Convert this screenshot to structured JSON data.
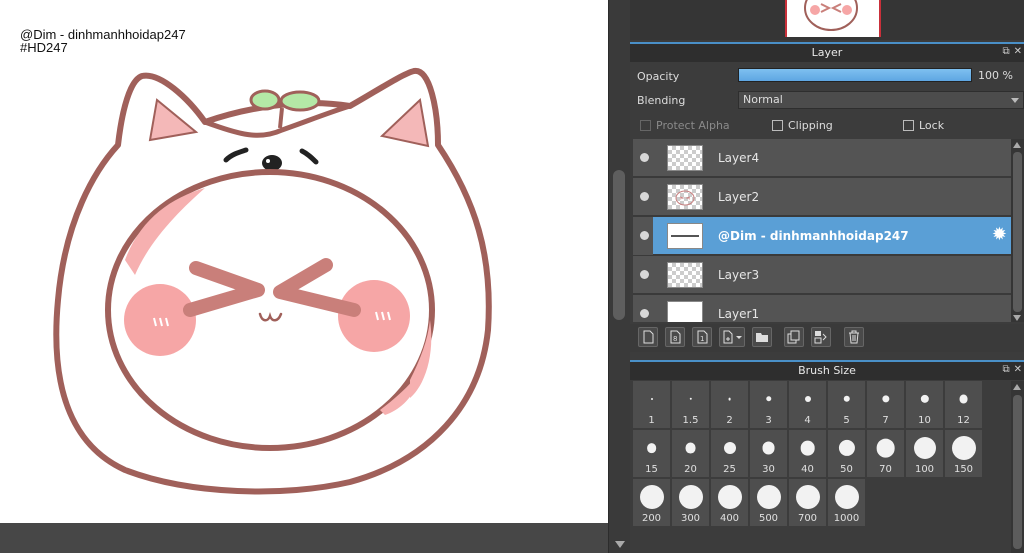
{
  "canvas": {
    "watermark_line1": "@Dim - dinhmanhhoidap247",
    "watermark_line2": "#HD247"
  },
  "layer_panel": {
    "title": "Layer",
    "opacity_label": "Opacity",
    "opacity_percent": 100,
    "opacity_text": "100 %",
    "blending_label": "Blending",
    "blending_value": "Normal",
    "protect_alpha_label": "Protect Alpha",
    "clipping_label": "Clipping",
    "lock_label": "Lock",
    "layers": [
      {
        "name": "Layer4",
        "thumb": "transparent",
        "visible": true,
        "selected": false
      },
      {
        "name": "Layer2",
        "thumb": "sketch",
        "visible": true,
        "selected": false
      },
      {
        "name": "@Dim - dinhmanhhoidap247",
        "thumb": "text",
        "visible": true,
        "selected": true
      },
      {
        "name": "Layer3",
        "thumb": "transparent",
        "visible": true,
        "selected": false
      },
      {
        "name": "Layer1",
        "thumb": "white",
        "visible": true,
        "selected": false
      }
    ],
    "toolbar_icons": [
      "new-layer-icon",
      "new-8bit-layer-icon",
      "new-1bit-layer-icon",
      "add-layer-menu-icon",
      "folder-icon",
      "duplicate-layer-icon",
      "merge-down-icon",
      "delete-layer-icon"
    ]
  },
  "brush_panel": {
    "title": "Brush Size",
    "sizes": [
      "1",
      "1.5",
      "2",
      "3",
      "4",
      "5",
      "7",
      "10",
      "12",
      "15",
      "20",
      "25",
      "30",
      "40",
      "50",
      "70",
      "100",
      "150",
      "200",
      "300",
      "400",
      "500",
      "700",
      "1000"
    ]
  },
  "colors": {
    "accent_blue": "#5a9fd6",
    "panel_bg": "#3c3c3c",
    "outline_brown": "#a0605a",
    "blush_pink": "#f6a6a6",
    "sprout_green": "#b4e8a6"
  }
}
